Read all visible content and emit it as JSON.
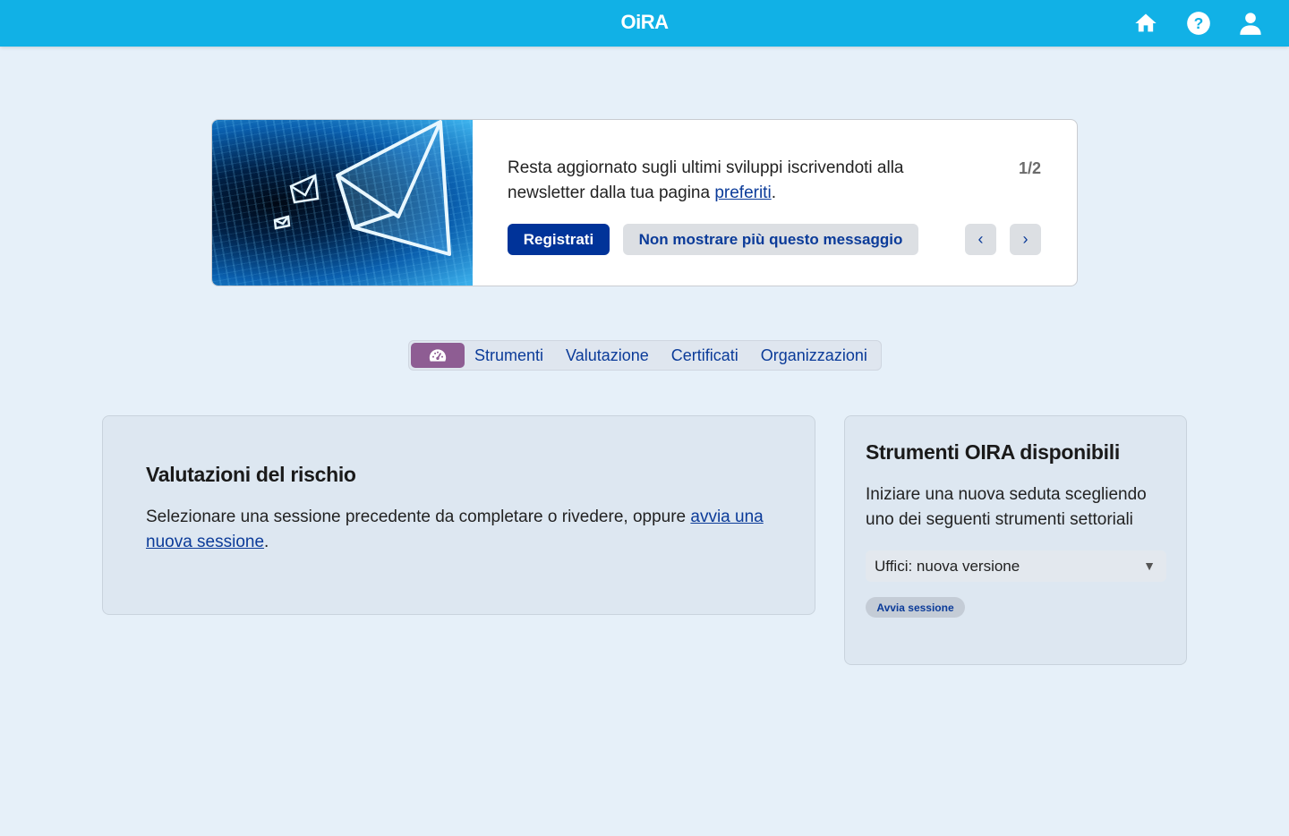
{
  "header": {
    "logo": "OiRA",
    "icons": [
      "home-icon",
      "help-icon",
      "user-icon"
    ]
  },
  "banner": {
    "text_before": "Resta aggiornato sugli ultimi sviluppi iscrivendoti alla newsletter dalla tua pagina ",
    "link_text": "preferiti",
    "text_after": ".",
    "counter": "1/2",
    "primary_button": "Registrati",
    "secondary_button": "Non mostrare più questo messaggio",
    "prev": "‹",
    "next": "›"
  },
  "tabs": {
    "items": [
      "Strumenti",
      "Valutazione",
      "Certificati",
      "Organizzazioni"
    ]
  },
  "risk_card": {
    "title": "Valutazioni del rischio",
    "text": "Selezionare una sessione precedente da completare o rivedere, oppure ",
    "link": "avvia una nuova sessione",
    "text_after": "."
  },
  "tools_card": {
    "title": "Strumenti OIRA disponibili",
    "text": "Iniziare una nuova seduta scegliendo uno dei seguenti strumenti settoriali",
    "select_value": "Uffici: nuova versione",
    "button": "Avvia sessione"
  },
  "colors": {
    "topbar": "#11b1e6",
    "primary": "#003399",
    "dashboard_tab": "#8e5d93",
    "background": "#e6f0f9"
  }
}
